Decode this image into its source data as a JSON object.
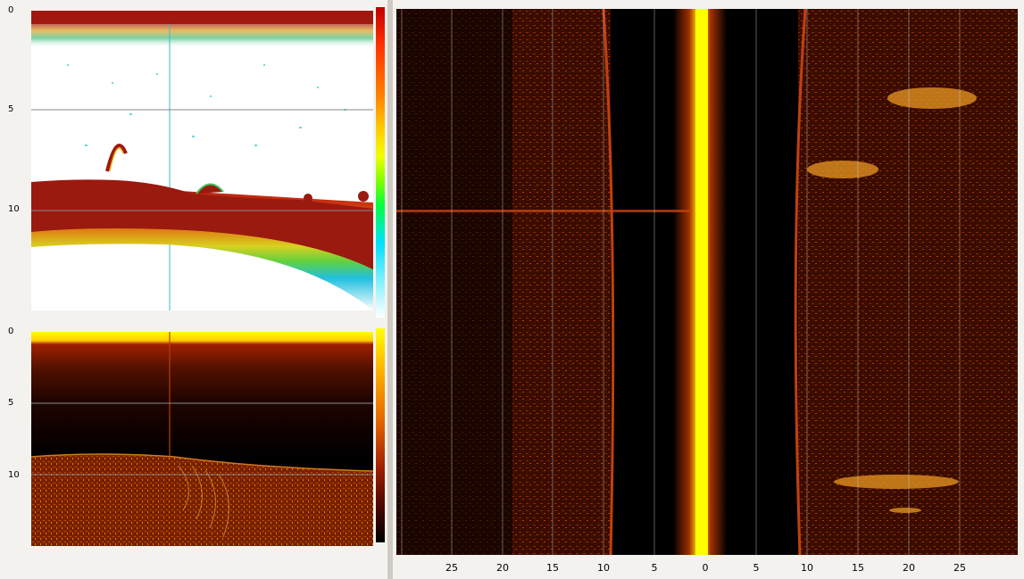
{
  "top_left_panel": {
    "depth_ticks": [
      "0",
      "5",
      "10"
    ],
    "colorbar_colors": [
      "#c00000",
      "#ff3000",
      "#ff8000",
      "#ffd000",
      "#f0ff00",
      "#80ff00",
      "#00ff40",
      "#00e0ff",
      "#ffffff"
    ]
  },
  "bottom_left_panel": {
    "depth_ticks": [
      "0",
      "5",
      "10"
    ],
    "colorbar_colors": [
      "#ffff00",
      "#ffb000",
      "#e06000",
      "#a02000",
      "#500800",
      "#000000"
    ]
  },
  "side_scan_panel": {
    "x_ticks": [
      "25",
      "20",
      "15",
      "10",
      "5",
      "0",
      "5",
      "10",
      "15",
      "20",
      "25"
    ],
    "palette": {
      "background": "#000000",
      "echo_low": "#5a1200",
      "echo_mid": "#c24a00",
      "echo_high": "#ffff00"
    }
  }
}
